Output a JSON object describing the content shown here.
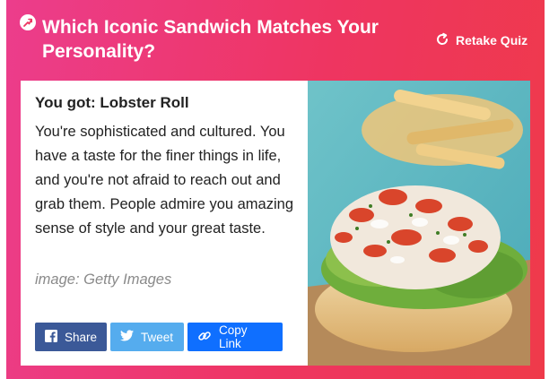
{
  "quiz": {
    "title": "Which Iconic Sandwich Matches Your Personality?",
    "retake_label": "Retake Quiz"
  },
  "result": {
    "heading": "You got: Lobster Roll",
    "description": "You're sophisticated and cultured. You have a taste for the finer things in life, and you're not afraid to reach out and grab them. People admire you amazing sense of style and your great taste.",
    "image_credit": "image: Getty Images"
  },
  "share": {
    "facebook_label": "Share",
    "twitter_label": "Tweet",
    "copy_label": "Copy Link"
  },
  "colors": {
    "header_gradient_start": "#ec3d8c",
    "header_gradient_end": "#ef3a4a",
    "facebook": "#3b5998",
    "twitter": "#55acee",
    "copy_link": "#0f6fff"
  },
  "icons": [
    "trending-icon",
    "retake-icon",
    "facebook-icon",
    "twitter-icon",
    "link-icon"
  ]
}
